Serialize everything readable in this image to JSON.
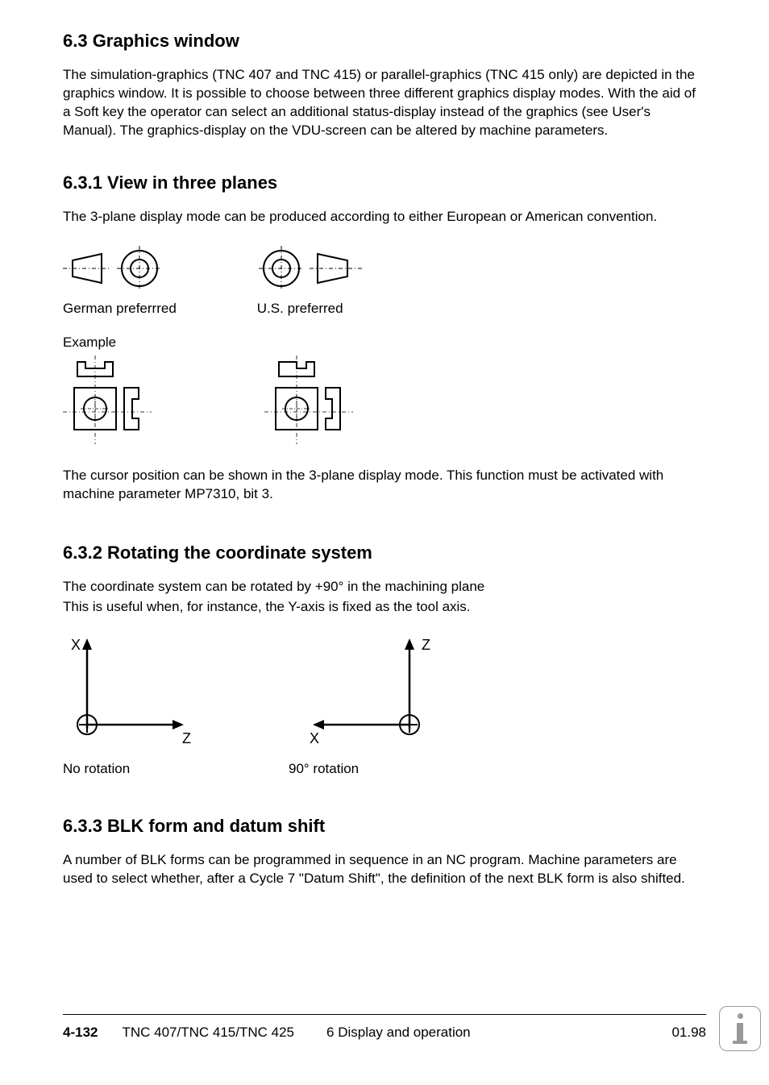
{
  "sections": {
    "s63": {
      "heading": "6.3  Graphics window",
      "para": "The simulation-graphics (TNC 407 and TNC 415) or parallel-graphics (TNC 415 only) are depicted in the graphics window. It is possible to choose between three different graphics display modes. With the aid of a Soft key the operator can select an additional status-display instead of the graphics (see  User's Manual).  The graphics-display on the VDU-screen can be altered by machine parameters."
    },
    "s631": {
      "heading": "6.3.1  View in three planes",
      "para1": "The 3-plane display mode can be produced according to either European or American convention.",
      "caption_left": "German preferrred",
      "caption_right": "U.S. preferred",
      "example_label": "Example",
      "para2": "The cursor position can be shown in the 3-plane display mode. This function must be activated with machine parameter MP7310, bit 3."
    },
    "s632": {
      "heading": "6.3.2  Rotating the coordinate system",
      "para1": "The coordinate system can be rotated by +90° in the machining plane",
      "para2": "This is useful when, for instance, the Y-axis is fixed as the tool axis.",
      "axis_left_v": "X",
      "axis_left_h": "Z",
      "caption_left": "No rotation",
      "axis_right_v": "Z",
      "axis_right_h": "X",
      "caption_right": "90° rotation"
    },
    "s633": {
      "heading": "6.3.3  BLK form and datum shift",
      "para": "A number of BLK forms can be programmed in sequence in an NC program. Machine parameters are used to select whether, after a Cycle 7 \"Datum Shift\", the definition of the next BLK form is also shifted."
    }
  },
  "footer": {
    "page": "4-132",
    "model": "TNC 407/TNC 415/TNC 425",
    "chapter": "6  Display and operation",
    "date": "01.98"
  }
}
